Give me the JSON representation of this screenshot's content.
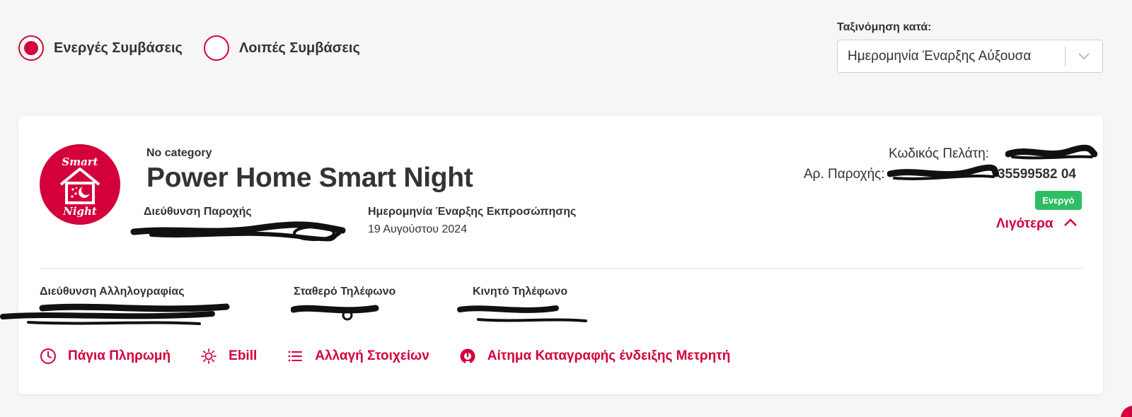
{
  "filters": {
    "active_label": "Ενεργές Συμβάσεις",
    "other_label": "Λοιπές Συμβάσεις",
    "selected": "active"
  },
  "sort": {
    "label": "Ταξινόμηση κατά:",
    "value": "Ημερομηνία Έναρξης Αύξουσα"
  },
  "contract": {
    "logo_line1": "Smart",
    "logo_line2": "Night",
    "category": "No category",
    "title": "Power Home Smart Night",
    "supply_address_label": "Διεύθυνση Παροχής",
    "start_date_label": "Ημερομηνία Έναρξης Εκπροσώπησης",
    "start_date_value": "19 Αυγούστου 2024",
    "customer_code_label": "Κωδικός Πελάτη:",
    "supply_number_label": "Αρ. Παροχής:",
    "supply_number_suffix": "35599582 04",
    "status": "Ενεργό",
    "toggle_label": "Λιγότερα",
    "mail_address_label": "Διεύθυνση Αλληλογραφίας",
    "landline_label": "Σταθερό Τηλέφωνο",
    "mobile_label": "Κινητό Τηλέφωνο"
  },
  "actions": [
    {
      "label": "Πάγια Πληρωμή",
      "icon": "clock-icon"
    },
    {
      "label": "Ebill",
      "icon": "sun-icon"
    },
    {
      "label": "Αλλαγή Στοιχείων",
      "icon": "list-icon"
    },
    {
      "label": "Αίτημα Καταγραφής ένδειξης Μετρητή",
      "icon": "meter-icon"
    }
  ],
  "colors": {
    "brand": "#d4003c",
    "status_active": "#2fbd63",
    "background": "#f6f6f6"
  }
}
